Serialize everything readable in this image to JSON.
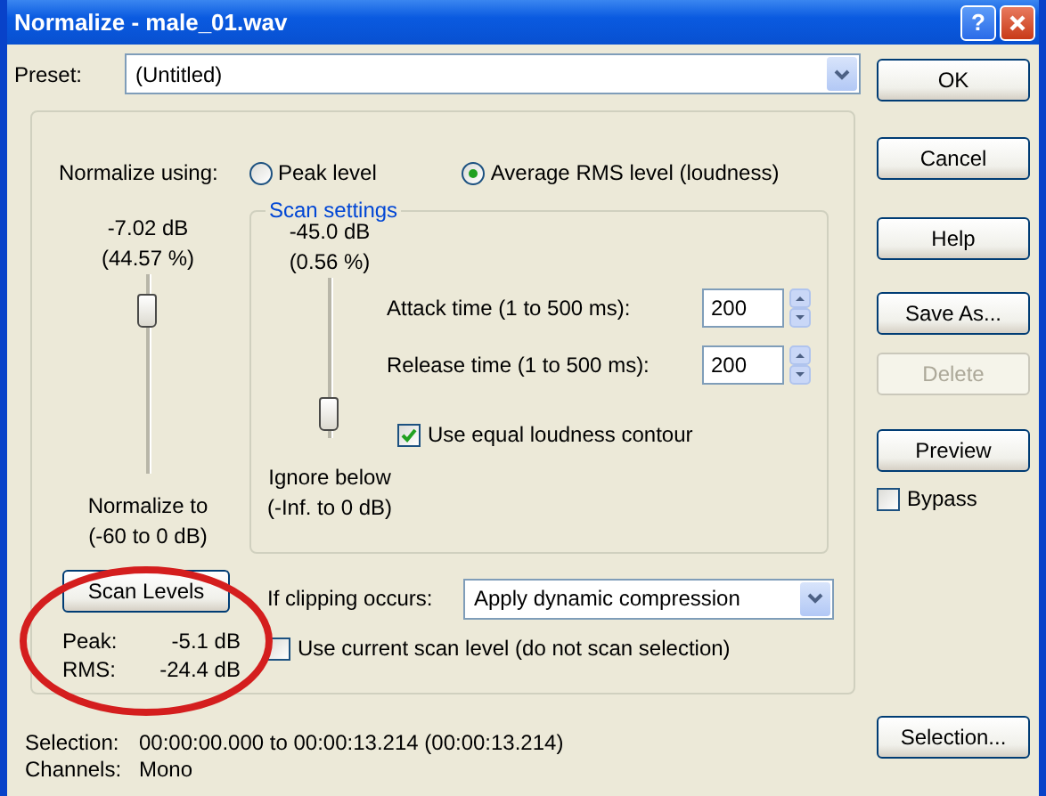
{
  "window": {
    "title": "Normalize - male_01.wav"
  },
  "title_buttons": [
    {
      "kind": "help",
      "label": "?"
    },
    {
      "kind": "close"
    }
  ],
  "preset": {
    "label": "Preset:",
    "value": "(Untitled)"
  },
  "normalize_using": {
    "label": "Normalize using:",
    "options": [
      {
        "label": "Peak level",
        "selected": false
      },
      {
        "label": "Average RMS level (loudness)",
        "selected": true
      }
    ]
  },
  "normalize_slider": {
    "reading": "-7.02 dB",
    "percent": "(44.57 %)",
    "level": 0.88,
    "caption": "Normalize to",
    "range": "(-60 to 0 dB)"
  },
  "scan_settings": {
    "title": "Scan settings",
    "slider": {
      "reading": "-45.0 dB",
      "percent": "(0.56 %)",
      "level": 0.05,
      "caption": "Ignore below",
      "range": "(-Inf. to 0 dB)"
    },
    "fields": [
      {
        "label": "Attack time (1 to 500 ms):",
        "value": "200"
      },
      {
        "label": "Release time (1 to 500 ms):",
        "value": "200"
      }
    ],
    "equal_loudness": {
      "label": "Use equal loudness contour",
      "checked": true
    }
  },
  "scan": {
    "button": "Scan Levels",
    "results": [
      {
        "label": "Peak:",
        "value": "-5.1 dB"
      },
      {
        "label": "RMS:",
        "value": "-24.4 dB"
      }
    ]
  },
  "clipping": {
    "label": "If clipping occurs:",
    "value": "Apply dynamic compression"
  },
  "use_current_scan": {
    "label": "Use current scan level (do not scan selection)",
    "checked": false
  },
  "status": [
    {
      "label": "Selection:",
      "value": "00:00:00.000 to 00:00:13.214 (00:00:13.214)"
    },
    {
      "label": "Channels:",
      "value": "Mono"
    }
  ],
  "buttons": [
    {
      "label": "OK",
      "disabled": false
    },
    {
      "label": "Cancel",
      "disabled": false
    },
    {
      "label": "Help",
      "disabled": false
    },
    {
      "label": "Save As...",
      "disabled": false
    },
    {
      "label": "Delete",
      "disabled": true
    },
    {
      "label": "Preview",
      "disabled": false
    }
  ],
  "bypass": {
    "label": "Bypass",
    "checked": false
  },
  "selection_button": {
    "label": "Selection..."
  }
}
